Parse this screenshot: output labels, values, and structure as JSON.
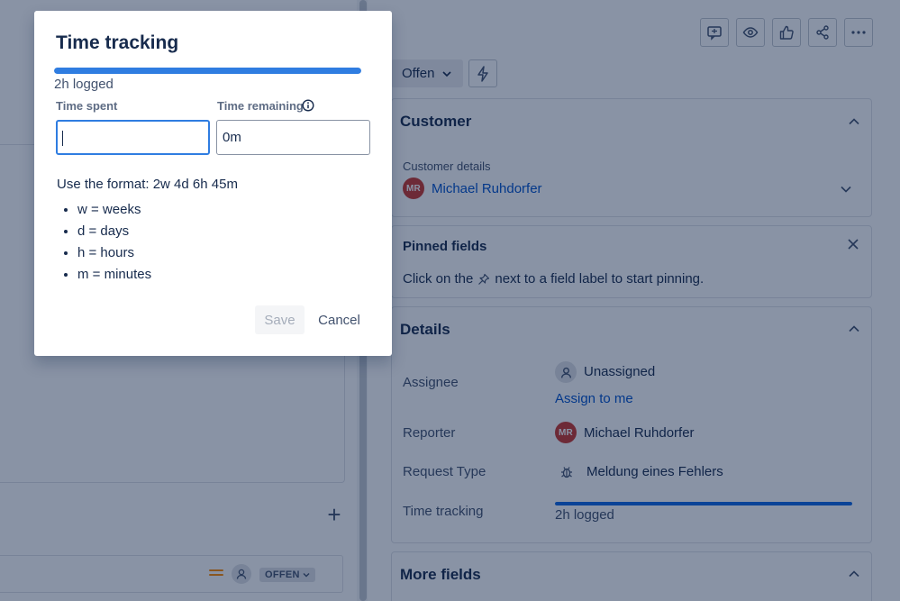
{
  "dialog": {
    "title": "Time tracking",
    "progress_fraction": 1.0,
    "logged_text": "2h logged",
    "time_spent_label": "Time spent",
    "time_spent_value": "",
    "time_remaining_label": "Time remaining",
    "time_remaining_value": "0m",
    "format_hint": "Use the format: 2w 4d 6h 45m",
    "units": [
      "w = weeks",
      "d = days",
      "h = hours",
      "m = minutes"
    ],
    "save_label": "Save",
    "cancel_label": "Cancel"
  },
  "issue": {
    "status": "Offen",
    "customer": {
      "title": "Customer",
      "details_label": "Customer details",
      "name": "Michael Ruhdorfer",
      "initials": "MR"
    },
    "pinned": {
      "title": "Pinned fields",
      "text_before": "Click on the",
      "text_after": "next to a field label to start pinning."
    },
    "details": {
      "title": "Details",
      "assignee_label": "Assignee",
      "assignee_value": "Unassigned",
      "assign_to_me": "Assign to me",
      "reporter_label": "Reporter",
      "reporter_value": "Michael Ruhdorfer",
      "reporter_initials": "MR",
      "request_type_label": "Request Type",
      "request_type_value": "Meldung eines Fehlers",
      "time_tracking_label": "Time tracking",
      "time_tracking_value": "2h logged",
      "time_tracking_fraction": 1.0
    },
    "more_fields_title": "More fields"
  },
  "left": {
    "row_status": "OFFEN"
  },
  "colors": {
    "progress": "#2f7de1",
    "avatar": "#c9372c",
    "link": "#0052cc",
    "priority": "#ff8b00"
  }
}
